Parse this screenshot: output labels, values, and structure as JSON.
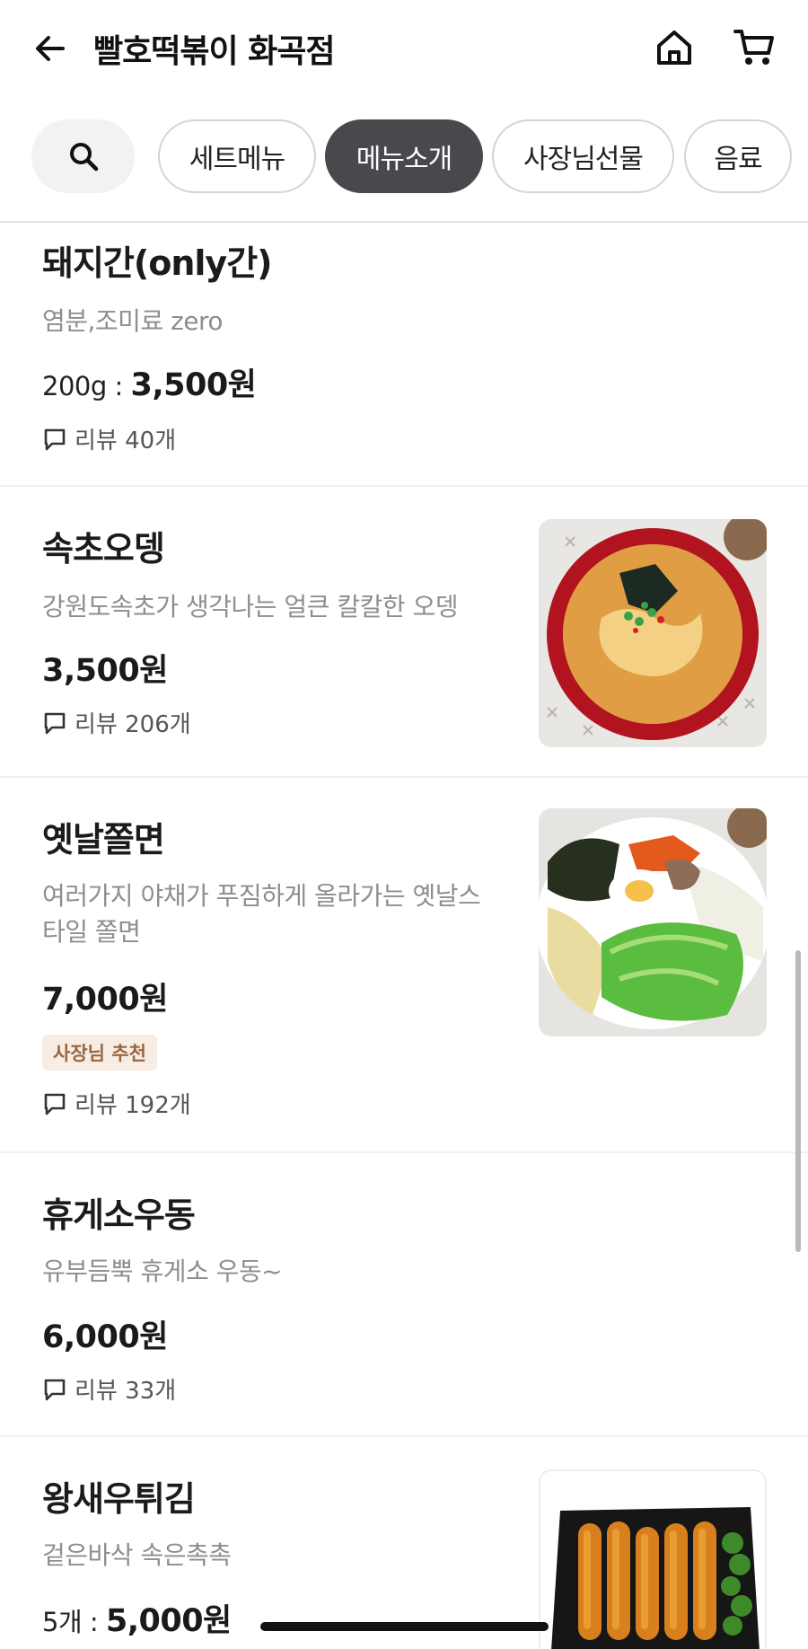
{
  "header": {
    "back_icon": "arrow-left-icon",
    "title": "빨호떡볶이 화곡점",
    "home_icon": "home-icon",
    "cart_icon": "cart-icon"
  },
  "tabs": {
    "search_icon": "search-icon",
    "items": [
      {
        "label": "세트메뉴",
        "active": false
      },
      {
        "label": "메뉴소개",
        "active": true
      },
      {
        "label": "사장님선물",
        "active": false
      },
      {
        "label": "음료",
        "active": false
      }
    ]
  },
  "menu": [
    {
      "name": "돼지간(only간)",
      "description": "염분,조미료 zero",
      "price_prefix": "200g : ",
      "price": "3,500원",
      "review": "리뷰 40개",
      "image": null
    },
    {
      "name": "속초오뎅",
      "description": "강원도속초가 생각나는 얼큰 칼칼한 오뎅",
      "price_prefix": "",
      "price": "3,500원",
      "review": "리뷰 206개",
      "image": "fish-cake-soup-photo"
    },
    {
      "name": "옛날쫄면",
      "description_line1": "여러가지 야채가 푸짐하게 올라가는 옛날스",
      "description_line2": "타일 쫄면",
      "price_prefix": "",
      "price": "7,000원",
      "badge": "사장님 추천",
      "review": "리뷰 192개",
      "image": "jjolmyeon-photo"
    },
    {
      "name": "휴게소우동",
      "description": "유부듬뿍 휴게소 우동~",
      "price_prefix": "",
      "price": "6,000원",
      "review": "리뷰 33개",
      "image": null
    },
    {
      "name": "왕새우튀김",
      "description": "겉은바삭 속은촉촉",
      "price_prefix": "5개 : ",
      "price": "5,000원",
      "review": "",
      "image": "fried-shrimp-photo"
    }
  ],
  "colors": {
    "active_tab": "#48494c",
    "badge_bg": "#f7ede5",
    "badge_text": "#9b6640",
    "desc_text": "#8e8e8e"
  }
}
